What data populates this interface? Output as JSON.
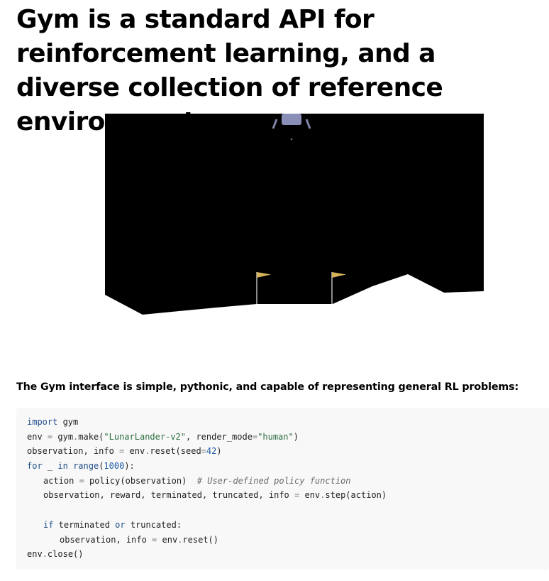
{
  "page": {
    "title": "Gym is a standard API for reinforcement learning, and a diverse collection of reference environments",
    "intro": "The Gym interface is simple, pythonic, and capable of representing general RL problems:"
  },
  "figure": {
    "icon": "lunar-lander-environment",
    "colors": {
      "sky": "#000000",
      "terrain": "#ffffff",
      "lander_body": "#8a8fb8",
      "lander_legs": "#7e83a8",
      "flag": "#d6b25a",
      "flagpole": "#e8e8e8"
    }
  },
  "code": {
    "line1": {
      "kw": "import",
      "rest": " gym"
    },
    "line2": {
      "a": "env ",
      "op": "=",
      "b": " gym",
      "dot": ".",
      "c": "make(",
      "s1": "\"LunarLander-v2\"",
      "d": ", render_mode",
      "op2": "=",
      "s2": "\"human\"",
      "e": ")"
    },
    "line3": {
      "a": "observation, info ",
      "op": "=",
      "b": " env",
      "dot": ".",
      "c": "reset(seed",
      "op2": "=",
      "num": "42",
      "d": ")"
    },
    "line4": {
      "kw": "for",
      "a": " _ ",
      "kw2": "in",
      "b": " ",
      "builtin": "range",
      "c": "(",
      "num": "1000",
      "d": "):"
    },
    "line5": {
      "a": "action ",
      "op": "=",
      "b": " policy(observation)  ",
      "comment": "# User-defined policy function"
    },
    "line6": {
      "a": "observation, reward, terminated, truncated, info ",
      "op": "=",
      "b": " env",
      "dot": ".",
      "c": "step(action)"
    },
    "line8": {
      "kw": "if",
      "a": " terminated ",
      "kw2": "or",
      "b": " truncated:"
    },
    "line9": {
      "a": "observation, info ",
      "op": "=",
      "b": " env",
      "dot": ".",
      "c": "reset()"
    },
    "line10": {
      "a": "env",
      "dot": ".",
      "c": "close()"
    }
  }
}
